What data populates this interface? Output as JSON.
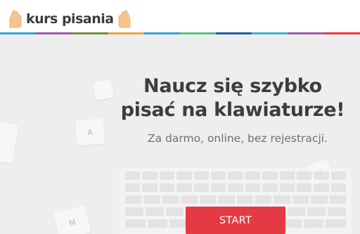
{
  "header": {
    "logo_text": "kurs pisania",
    "stripe_colors": [
      "#3b9fd8",
      "#9d5fa3",
      "#7c8c3b",
      "#e8a64a",
      "#3b9fd8",
      "#5fbf89",
      "#1d5ea8",
      "#3fb6c8",
      "#9d5fa3",
      "#e53a43"
    ]
  },
  "hero": {
    "headline_line1": "Naucz się szybko",
    "headline_line2": "pisać na klawiaturze!",
    "subtitle": "Za darmo, online, bez rejestracji.",
    "start_label": "START",
    "floating_keys": [
      "A",
      "U",
      "M"
    ]
  },
  "colors": {
    "accent": "#e53a43",
    "background": "#eeeeee",
    "heading": "#3d3d3d"
  }
}
